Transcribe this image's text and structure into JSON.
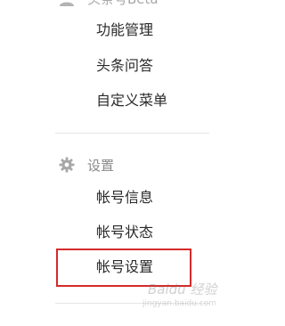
{
  "top_section": {
    "label": "头条号Beta",
    "icon": "user-icon"
  },
  "top_menu": [
    {
      "label": "功能管理"
    },
    {
      "label": "头条问答"
    },
    {
      "label": "自定义菜单"
    }
  ],
  "settings_section": {
    "label": "设置",
    "icon": "gear-icon"
  },
  "settings_menu": [
    {
      "label": "帐号信息"
    },
    {
      "label": "帐号状态"
    },
    {
      "label": "帐号设置",
      "highlighted": true
    }
  ],
  "watermark": {
    "brand": "Baidu 经验",
    "url": "jingyan.baidu.com"
  },
  "colors": {
    "highlight_border": "#d42b2b",
    "menu_text": "#2a2a2a",
    "section_text": "#8a8a8a",
    "divider": "#e6e6e6"
  }
}
